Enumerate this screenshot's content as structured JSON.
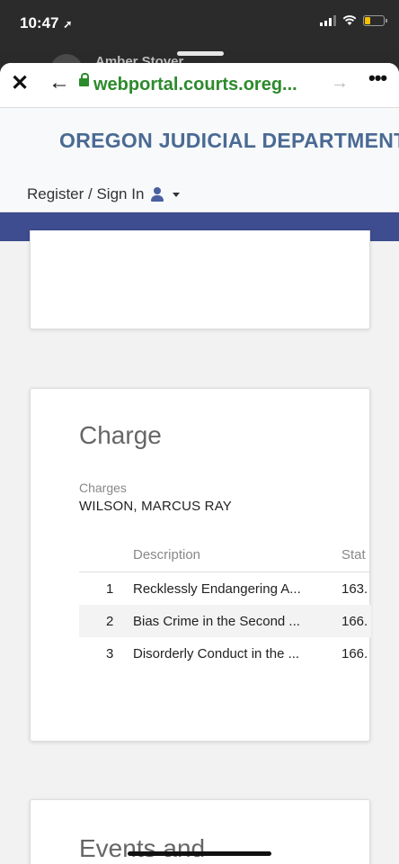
{
  "status_bar": {
    "time": "10:47",
    "location_glyph": "➚",
    "battery_color": "#f5c000"
  },
  "behind_sheet": {
    "name": "Amber Stover"
  },
  "browser": {
    "close_glyph": "✕",
    "back_glyph": "←",
    "url": "webportal.courts.oreg...",
    "forward_glyph": "→",
    "more_glyph": "•••",
    "url_color": "#2c8a2c"
  },
  "site": {
    "title": "OREGON JUDICIAL DEPARTMENT",
    "signin_label": "Register / Sign In",
    "title_color": "#4a6a93",
    "nav_color": "#3e4d8f"
  },
  "charge_section": {
    "title": "Charge",
    "charges_label": "Charges",
    "defendant": "WILSON, MARCUS RAY",
    "columns": [
      "Description",
      "Stat"
    ],
    "rows": [
      {
        "num": "1",
        "description": "Recklessly Endangering A...",
        "statute": "163."
      },
      {
        "num": "2",
        "description": "Bias Crime in the Second ...",
        "statute": "166."
      },
      {
        "num": "3",
        "description": "Disorderly Conduct in the ...",
        "statute": "166."
      }
    ]
  },
  "events_section": {
    "title": "Events and"
  }
}
